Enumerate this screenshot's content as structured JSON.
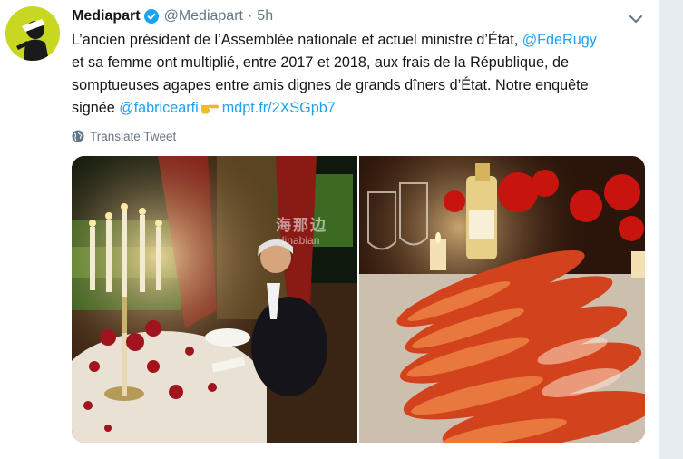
{
  "account": {
    "name": "Mediapart",
    "handle": "@Mediapart",
    "separator": "·",
    "time": "5h"
  },
  "tweet": {
    "line1_text": "L’ancien président de l’Assemblée nationale et actuel ministre d’État, ",
    "line1_mention": "@FdeRugy",
    "line2": "et sa femme ont multiplié, entre 2017 et 2018, aux frais de la République, de",
    "line3": "somptueuses agapes entre amis dignes de grands dîners d’État. Notre enquête",
    "line4_text": "signée ",
    "line4_mention": "@fabricearfi",
    "line4_link": "mdpt.fr/2XSGpb7"
  },
  "translate_label": "Translate Tweet",
  "media": {
    "watermark": "海那边",
    "watermark_sub": "Hinabian"
  },
  "colors": {
    "link": "#1da1f2",
    "secondary_text": "#657786",
    "verified": "#1da1f2"
  },
  "icons": [
    "mediapart-avatar",
    "verified-badge-icon",
    "chevron-down-icon",
    "pointing-hand-emoji",
    "globe-icon"
  ]
}
